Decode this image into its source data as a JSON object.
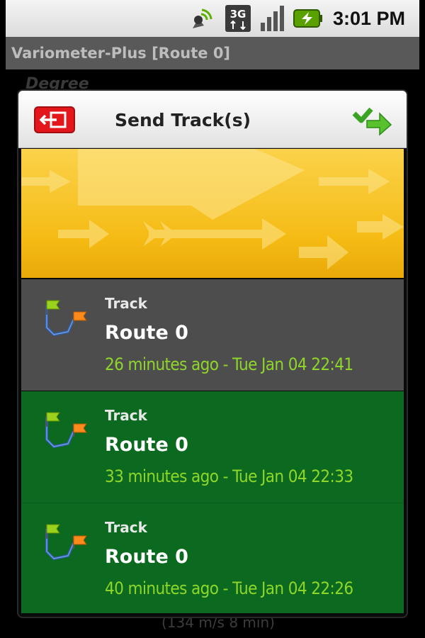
{
  "status_bar": {
    "time": "3:01 PM",
    "network_label": "3G",
    "icons": [
      "gps-icon",
      "network-3g-icon",
      "signal-icon",
      "battery-icon"
    ]
  },
  "app": {
    "title": "Variometer-Plus [Route 0]"
  },
  "background": {
    "top_text": "Degree",
    "bottom_text": "(134 m/s 8 min)"
  },
  "dialog": {
    "title": "Send Track(s)",
    "back_icon": "back-exit-icon",
    "send_icon": "send-arrow-icon",
    "tracks": [
      {
        "type": "Track",
        "name": "Route 0",
        "time": "26 minutes ago - Tue Jan 04 22:41",
        "selected": false
      },
      {
        "type": "Track",
        "name": "Route 0",
        "time": "33 minutes ago - Tue Jan 04 22:33",
        "selected": true
      },
      {
        "type": "Track",
        "name": "Route 0",
        "time": "40 minutes ago - Tue Jan 04 22:26",
        "selected": true
      }
    ]
  },
  "colors": {
    "banner": "#f5bb14",
    "row_unselected": "#4d4d4d",
    "row_selected": "#0b6a1f",
    "time_text": "#8fd62b"
  }
}
